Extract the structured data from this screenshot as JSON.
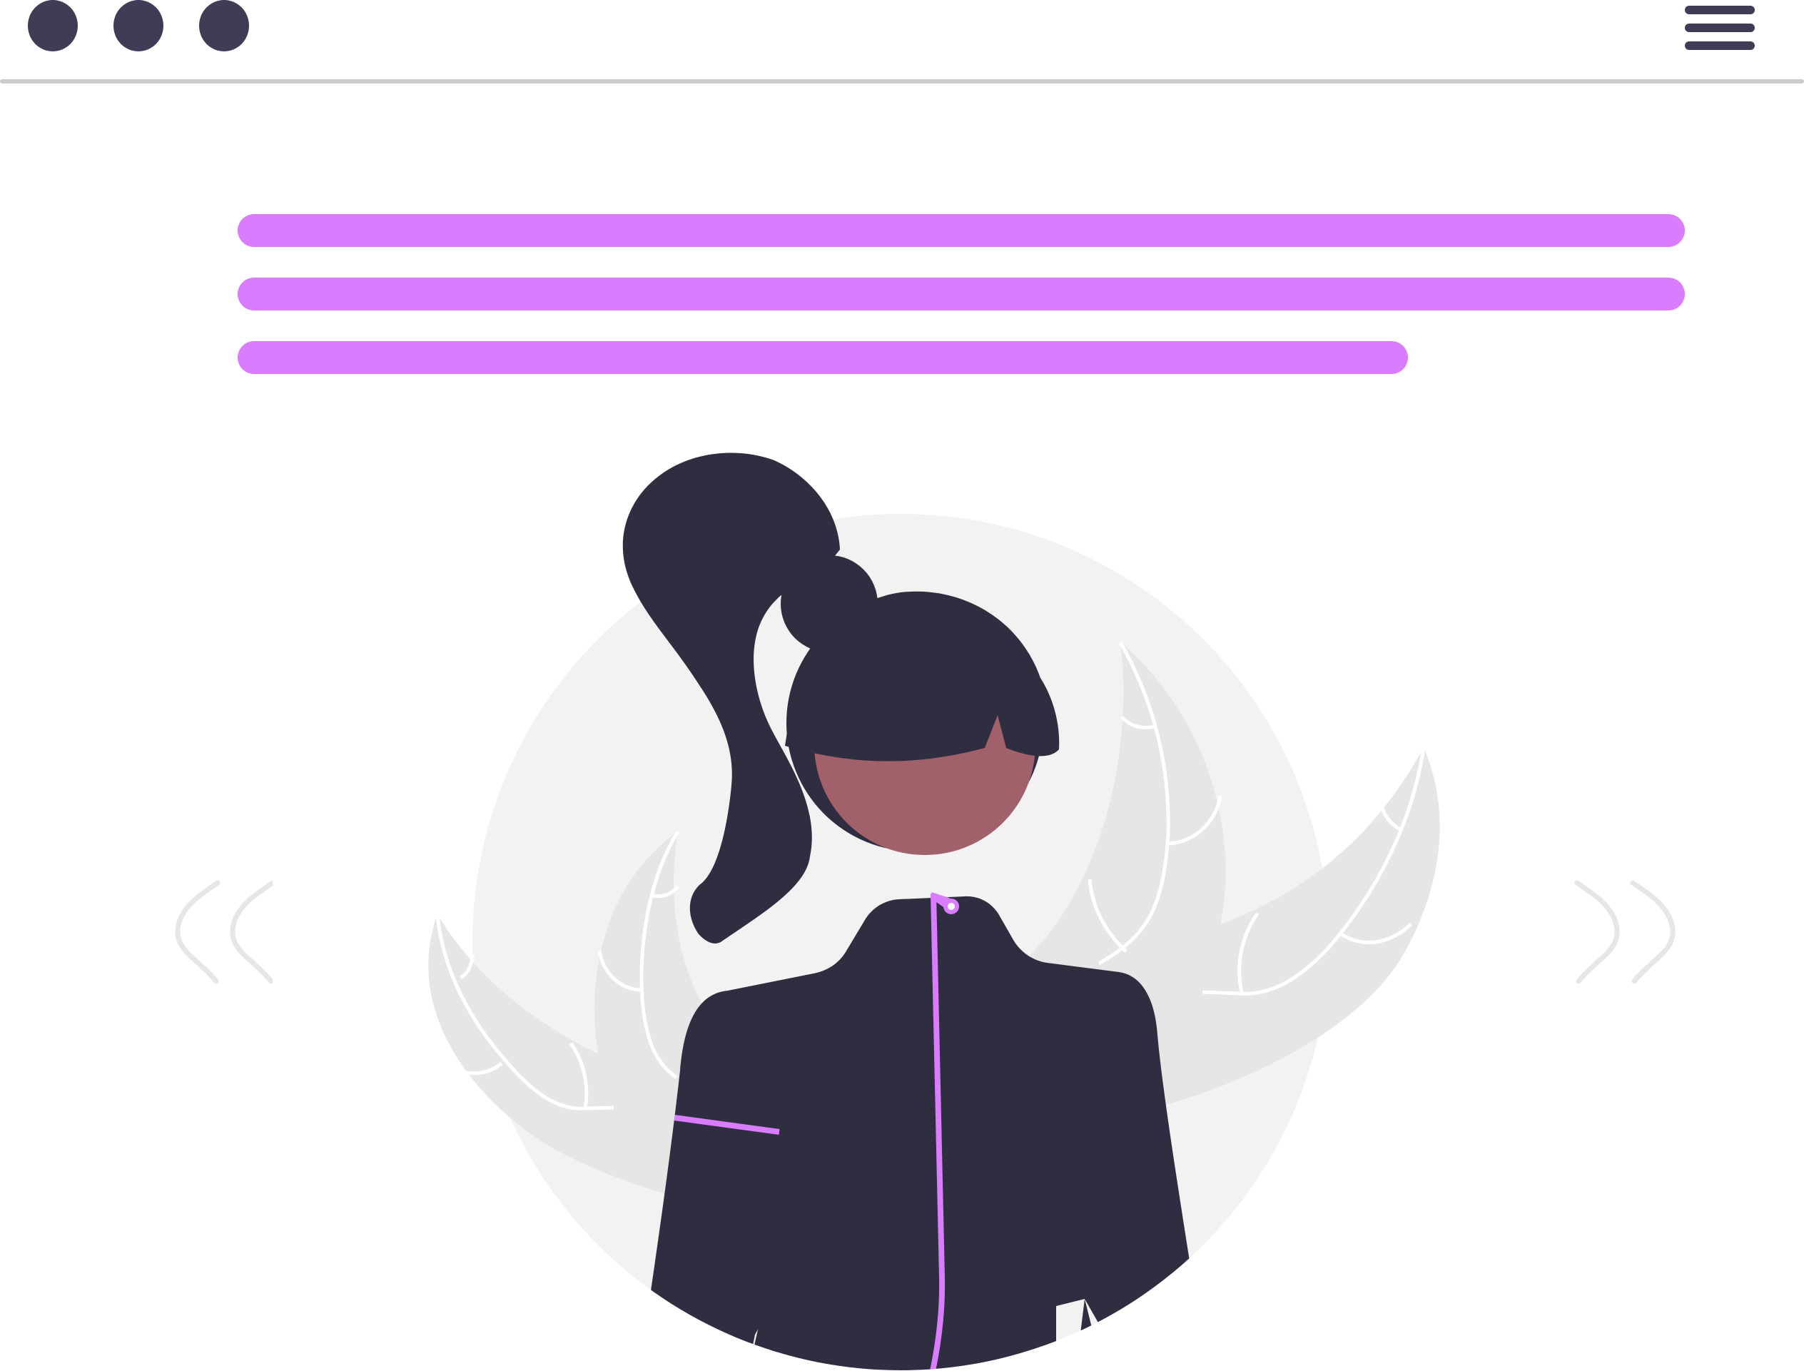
{
  "app": {
    "window_controls": [
      "dot-icon",
      "dot-icon",
      "dot-icon"
    ],
    "menu_icon": "hamburger-menu-icon"
  },
  "content": {
    "text_placeholder_lines": 3,
    "illustration": "woman-portrait-illustration",
    "prev_icon": "chevron-left-double-icon",
    "next_icon": "chevron-right-double-icon"
  },
  "colors": {
    "window_dot": "#3f3d56",
    "menu_line": "#3f3d56",
    "divider": "#cccccc",
    "accent": "#d97cfd",
    "circle_bg": "#f2f2f2",
    "leaf": "#e6e6e6",
    "arrow": "#e6e6e6",
    "hair": "#2f2e41",
    "skin": "#a0616a",
    "jacket": "#2f2e41"
  }
}
